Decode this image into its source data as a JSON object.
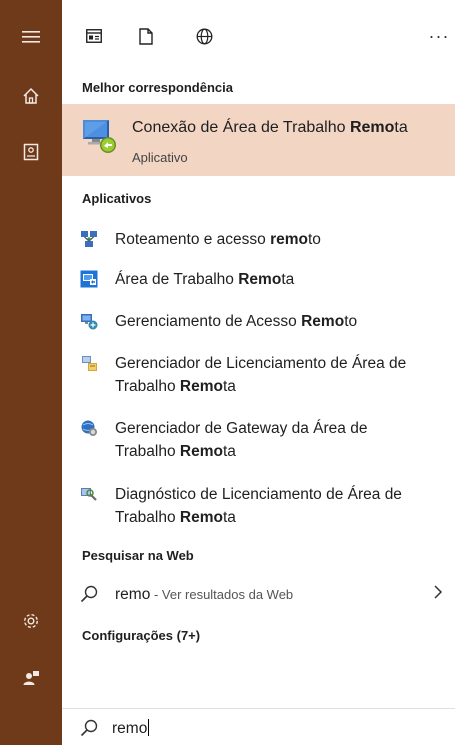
{
  "sections": {
    "best_match": "Melhor correspondência",
    "apps": "Aplicativos",
    "web": "Pesquisar na Web",
    "settings": "Configurações (7+)"
  },
  "best_match": {
    "title_pre": "Conexão de Área de Trabalho ",
    "title_bold": "Remo",
    "title_post": "ta",
    "subtitle": "Aplicativo"
  },
  "apps": [
    {
      "pre": "Roteamento e acesso ",
      "bold": "remo",
      "post": "to",
      "icon": "routing-icon",
      "cont_pre": "",
      "cont_bold": "",
      "cont_post": ""
    },
    {
      "pre": "Área de Trabalho ",
      "bold": "Remo",
      "post": "ta",
      "icon": "remote-desktop-icon",
      "cont_pre": "",
      "cont_bold": "",
      "cont_post": ""
    },
    {
      "pre": "Gerenciamento de Acesso ",
      "bold": "Remo",
      "post": "to",
      "icon": "remote-access-icon",
      "cont_pre": "",
      "cont_bold": "",
      "cont_post": ""
    },
    {
      "pre": "Gerenciador de Licenciamento de Área de",
      "bold": "",
      "post": "",
      "icon": "licensing-manager-icon",
      "cont_pre": "Trabalho ",
      "cont_bold": "Remo",
      "cont_post": "ta"
    },
    {
      "pre": "Gerenciador de Gateway da Área de",
      "bold": "",
      "post": "",
      "icon": "gateway-manager-icon",
      "cont_pre": "Trabalho ",
      "cont_bold": "Remo",
      "cont_post": "ta"
    },
    {
      "pre": "Diagnóstico de Licenciamento de Área de",
      "bold": "",
      "post": "",
      "icon": "licensing-diagnoser-icon",
      "cont_pre": "Trabalho ",
      "cont_bold": "Remo",
      "cont_post": "ta"
    }
  ],
  "web": {
    "query": "remo",
    "suffix": " - Ver resultados da Web"
  },
  "search": {
    "value": "remo"
  },
  "colors": {
    "rail": "#6e3a1a",
    "highlight": "#f2d5c3"
  }
}
